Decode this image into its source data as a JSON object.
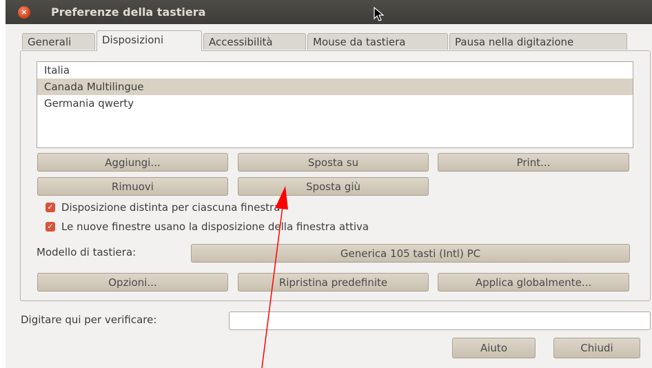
{
  "window": {
    "title": "Preferenze della tastiera"
  },
  "tabs": [
    {
      "label": "Generali"
    },
    {
      "label": "Disposizioni",
      "active": true
    },
    {
      "label": "Accessibilità"
    },
    {
      "label": "Mouse da tastiera"
    },
    {
      "label": "Pausa nella digitazione"
    }
  ],
  "layouts": {
    "items": [
      "Italia",
      "Canada Multilingue",
      "Germania qwerty"
    ],
    "selected_index": 1
  },
  "buttons": {
    "add": "Aggiungi...",
    "move_up": "Sposta su",
    "print": "Print...",
    "remove": "Rimuovi",
    "move_down": "Sposta giù",
    "options": "Opzioni...",
    "reset": "Ripristina predefinite",
    "apply_globally": "Applica globalmente...",
    "help": "Aiuto",
    "close": "Chiudi"
  },
  "checkboxes": {
    "separate_layout": {
      "label": "Disposizione distinta per ciascuna finestra",
      "checked": true
    },
    "new_windows": {
      "label": "Le nuove finestre usano la disposizione della finestra attiva",
      "checked": true
    }
  },
  "keyboard_model": {
    "label": "Modello di tastiera:",
    "value": "Generica 105 tasti (Intl) PC"
  },
  "test_field": {
    "label": "Digitare qui per verificare:",
    "value": ""
  },
  "colors": {
    "accent": "#d9533a",
    "annotation_arrow": "#ff0000",
    "titlebar": "#3d3c38"
  }
}
